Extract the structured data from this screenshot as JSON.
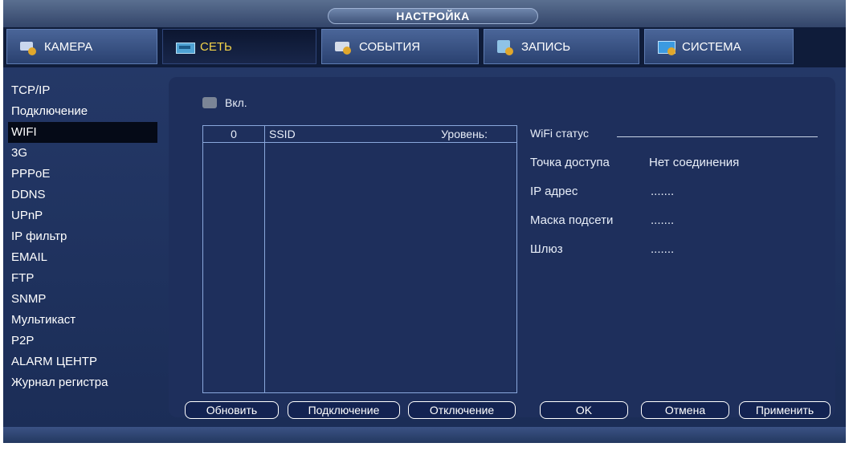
{
  "window": {
    "title": "НАСТРОЙКА"
  },
  "tabs": [
    {
      "label": "КАМЕРА",
      "icon": "camera-icon",
      "active": false
    },
    {
      "label": "СЕТЬ",
      "icon": "network-icon",
      "active": true
    },
    {
      "label": "СОБЫТИЯ",
      "icon": "events-icon",
      "active": false
    },
    {
      "label": "ЗАПИСЬ",
      "icon": "record-icon",
      "active": false
    },
    {
      "label": "СИСТЕМА",
      "icon": "system-icon",
      "active": false
    }
  ],
  "sidebar": {
    "items": [
      {
        "label": "TCP/IP"
      },
      {
        "label": "Подключение"
      },
      {
        "label": "WIFI",
        "active": true
      },
      {
        "label": "3G"
      },
      {
        "label": "PPPoE"
      },
      {
        "label": "DDNS"
      },
      {
        "label": "UPnP"
      },
      {
        "label": "IP фильтр"
      },
      {
        "label": "EMAIL"
      },
      {
        "label": "FTP"
      },
      {
        "label": "SNMP"
      },
      {
        "label": "Мультикаст"
      },
      {
        "label": "P2P"
      },
      {
        "label": "ALARM ЦЕНТР"
      },
      {
        "label": "Журнал регистра"
      }
    ]
  },
  "wifi": {
    "enable_label": "Вкл.",
    "enabled": false,
    "list": {
      "col_num": "0",
      "col_ssid": "SSID",
      "col_level": "Уровень:"
    },
    "status": {
      "title": "WiFi статус",
      "ap_label": "Точка доступа",
      "ap_value": "Нет соединения",
      "ip_label": "IP адрес",
      "ip_value": ".......",
      "mask_label": "Маска подсети",
      "mask_value": ".......",
      "gw_label": "Шлюз",
      "gw_value": "......."
    }
  },
  "buttons": {
    "refresh": "Обновить",
    "connect": "Подключение",
    "disconnect": "Отключение",
    "ok": "OK",
    "cancel": "Отмена",
    "apply": "Применить"
  },
  "colors": {
    "accent_active_tab": "#f3d34a",
    "panel_bg": "#1e2f5c",
    "main_bg": "#243867"
  }
}
